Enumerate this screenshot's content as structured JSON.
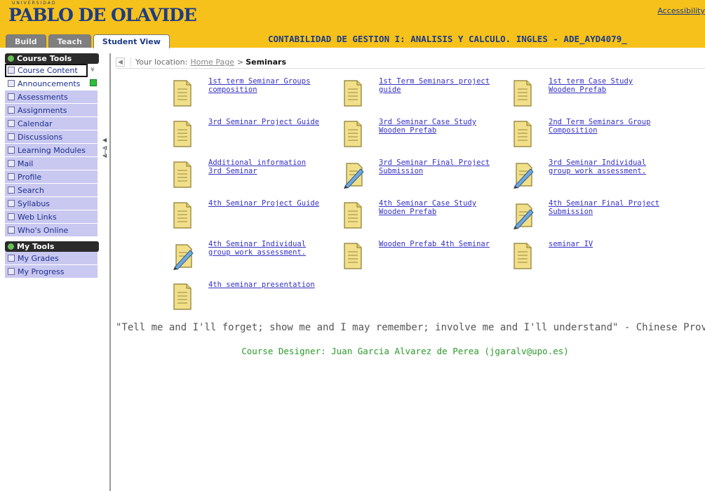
{
  "header": {
    "logo_text": "PABLO DE OLAVIDE",
    "logo_subtext": "UNIVERSIDAD",
    "accessibility_label": "Accessibility",
    "tabs": [
      {
        "label": "Build"
      },
      {
        "label": "Teach"
      },
      {
        "label": "Student View"
      }
    ],
    "course_title": "CONTABILIDAD DE GESTION I: ANALISIS Y CALCULO. INGLES - ADE_AYD4079_"
  },
  "sidebar": {
    "course_tools_title": "Course Tools",
    "course_tools": [
      {
        "label": "Course Content"
      },
      {
        "label": "Announcements"
      },
      {
        "label": "Assessments"
      },
      {
        "label": "Assignments"
      },
      {
        "label": "Calendar"
      },
      {
        "label": "Discussions"
      },
      {
        "label": "Learning Modules"
      },
      {
        "label": "Mail"
      },
      {
        "label": "Profile"
      },
      {
        "label": "Search"
      },
      {
        "label": "Syllabus"
      },
      {
        "label": "Web Links"
      },
      {
        "label": "Who's Online"
      }
    ],
    "my_tools_title": "My Tools",
    "my_tools": [
      {
        "label": "My Grades"
      },
      {
        "label": "My Progress"
      }
    ]
  },
  "breadcrumb": {
    "prefix": "Your location:",
    "home": "Home Page",
    "separator": ">",
    "current": "Seminars"
  },
  "items": [
    {
      "label": "1st term Seminar Groups composition",
      "icon": "document-icon"
    },
    {
      "label": "1st Term Seminars project guide",
      "icon": "document-icon"
    },
    {
      "label": "1st term Case Study  Wooden Prefab",
      "icon": "document-icon"
    },
    {
      "label": "3rd Seminar Project Guide",
      "icon": "document-icon"
    },
    {
      "label": "3rd Seminar  Case Study  Wooden Prefab",
      "icon": "document-icon"
    },
    {
      "label": "2nd Term Seminars Group Composition",
      "icon": "document-icon"
    },
    {
      "label": "Additional information  3rd Seminar",
      "icon": "document-icon"
    },
    {
      "label": "3rd Seminar Final Project Submission",
      "icon": "assignment-icon"
    },
    {
      "label": "3rd Seminar  Individual group work assessment.",
      "icon": "assignment-icon"
    },
    {
      "label": "4th Seminar Project Guide",
      "icon": "document-icon"
    },
    {
      "label": "4th Seminar  Case Study  Wooden Prefab",
      "icon": "document-icon"
    },
    {
      "label": "4th Seminar Final Project Submission",
      "icon": "assignment-icon"
    },
    {
      "label": "4th Seminar Individual group work assessment.",
      "icon": "assignment-icon"
    },
    {
      "label": "Wooden Prefab  4th Seminar",
      "icon": "document-icon"
    },
    {
      "label": "seminar IV",
      "icon": "document-icon"
    },
    {
      "label": "4th seminar presentation",
      "icon": "document-icon"
    }
  ],
  "quote": "\"Tell me and I'll forget; show me and I may remember; involve me and I'll understand\" - Chinese Proverb",
  "designer": "Course Designer: Juan Garcia Alvarez de Perea (jgaralv@upo.es)",
  "colors": {
    "header_bg": "#f6c11a",
    "link": "#3431c2",
    "tool_bg": "#c8c8f0",
    "designer_text": "#2a9a2a"
  }
}
